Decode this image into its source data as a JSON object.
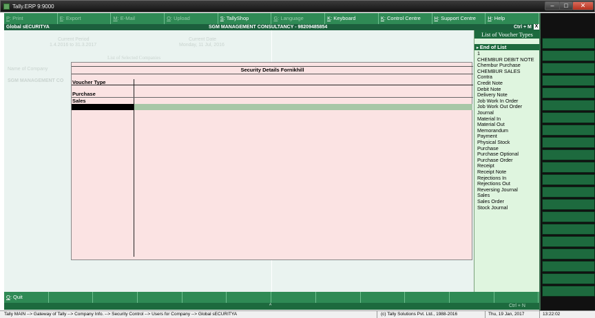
{
  "window": {
    "title": "Tally.ERP 9:9000"
  },
  "topbar": [
    {
      "key": "P",
      "label": ": Print",
      "enabled": false
    },
    {
      "key": "E",
      "label": ": Export",
      "enabled": false
    },
    {
      "key": "M",
      "label": ": E-Mail",
      "enabled": false
    },
    {
      "key": "O",
      "label": ": Upload",
      "enabled": false
    },
    {
      "key": "S",
      "label": ": TallyShop",
      "enabled": true
    },
    {
      "key": "G",
      "label": ": Language",
      "enabled": false
    },
    {
      "key": "K",
      "label": ": Keyboard",
      "enabled": true
    },
    {
      "key": "K",
      "label": ": Control Centre",
      "enabled": true
    },
    {
      "key": "H",
      "label": ": Support Centre",
      "enabled": true
    },
    {
      "key": "H",
      "label": ": Help",
      "enabled": true
    }
  ],
  "header": {
    "left": "Global sECURITYA",
    "center": "SGM MANAGEMENT CONSULTANCY - 98209485854",
    "ctrl": "Ctrl + M",
    "close": "X"
  },
  "background": {
    "current_period_label": "Current Period",
    "current_period_value": "1.4.2016 to 31.3.2017",
    "current_date_label": "Current Date",
    "current_date_value": "Monday, 11 Jul, 2016",
    "selected_companies": "List of Selected Companies",
    "name_of_company": "Name of Company",
    "company_name": "SGM MANAGEMENT CO"
  },
  "security_panel": {
    "title": "Security Details Fornikhill",
    "column_header": "Voucher Type",
    "rows": [
      "Purchase",
      "Sales"
    ]
  },
  "voucher_list": {
    "title": "List of Voucher Types",
    "end_of_list": "End of List",
    "items": [
      "1",
      "CHEMBUR DEBIT NOTE",
      "Chembur Purchase",
      "CHEMBUR SALES",
      "Contra",
      "Credit Note",
      "Debit Note",
      "Delivery Note",
      "Job Work In Order",
      "Job Work Out Order",
      "Journal",
      "Material In",
      "Material Out",
      "Memorandum",
      "Payment",
      "Physical Stock",
      "Purchase",
      "Purchase Optional",
      "Purchase Order",
      "Receipt",
      "Receipt Note",
      "Rejections In",
      "Rejections Out",
      "Reversing Journal",
      "Sales",
      "Sales Order",
      "Stock Journal"
    ]
  },
  "bottombar": {
    "quit_key": "Q",
    "quit_label": ": Quit",
    "caret": "^",
    "ctrl_n": "Ctrl + N"
  },
  "statusbar": {
    "path": "Tally MAIN --> Gateway of Tally --> Company Info. --> Security Control --> Users for Company --> Global sECURITYA",
    "copyright": "(c) Tally Solutions Pvt. Ltd., 1988-2016",
    "date": "Thu, 19 Jan, 2017",
    "time": "13:22:02"
  },
  "colors": {
    "menu_green": "#2f8a55",
    "header_green": "#1c5f3d",
    "panel_pink": "#fbe3e3",
    "list_bg": "#dff5df"
  }
}
